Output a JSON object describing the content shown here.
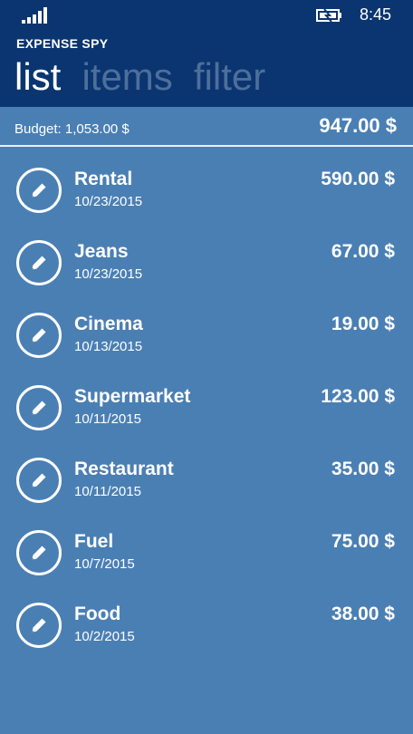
{
  "status": {
    "time": "8:45"
  },
  "app": {
    "title": "EXPENSE SPY"
  },
  "pivots": [
    "list",
    "items",
    "filter"
  ],
  "budget": {
    "label": "Budget: 1,053.00 $",
    "remaining": "947.00 $"
  },
  "expenses": [
    {
      "name": "Rental",
      "date": "10/23/2015",
      "amount": "590.00 $"
    },
    {
      "name": "Jeans",
      "date": "10/23/2015",
      "amount": "67.00 $"
    },
    {
      "name": "Cinema",
      "date": "10/13/2015",
      "amount": "19.00 $"
    },
    {
      "name": "Supermarket",
      "date": "10/11/2015",
      "amount": "123.00 $"
    },
    {
      "name": "Restaurant",
      "date": "10/11/2015",
      "amount": "35.00 $"
    },
    {
      "name": "Fuel",
      "date": "10/7/2015",
      "amount": "75.00 $"
    },
    {
      "name": "Food",
      "date": "10/2/2015",
      "amount": "38.00 $"
    }
  ],
  "icons": {
    "signal": "signal-strength-icon",
    "battery": "battery-charging-icon",
    "edit": "pencil-icon"
  },
  "colors": {
    "header_bg": "#0b3570",
    "list_bg": "#4a7fb4",
    "pivot_inactive": "#4d6f9a",
    "text": "#ffffff"
  }
}
